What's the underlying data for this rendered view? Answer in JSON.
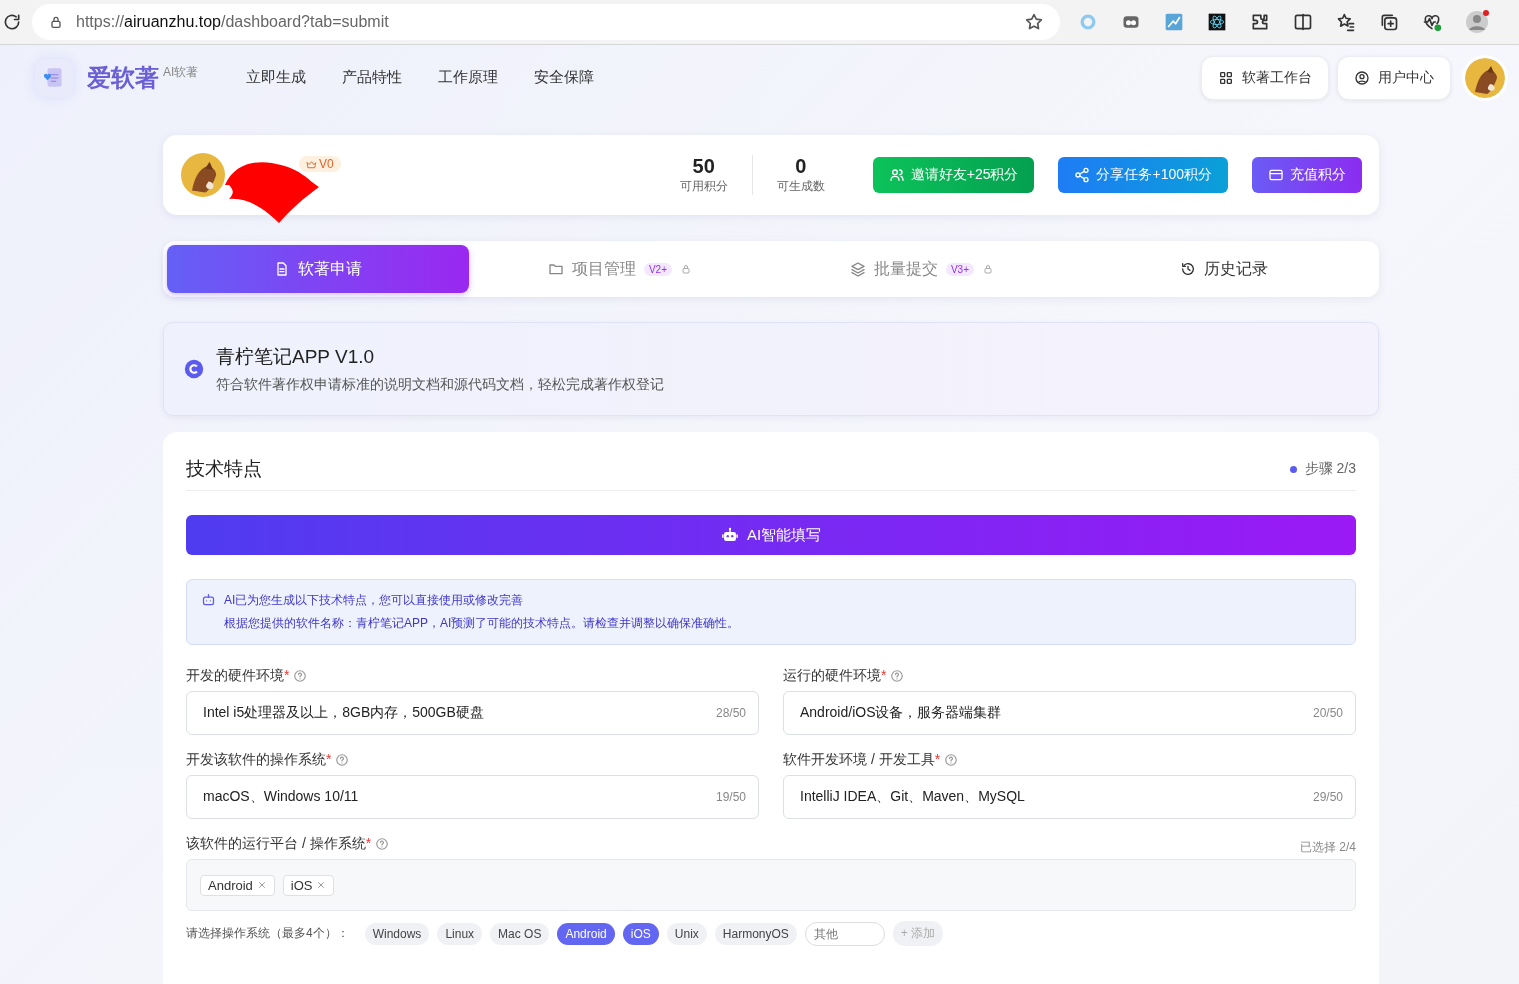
{
  "browser": {
    "url_scheme": "https://",
    "url_host": "airuanzhu.top",
    "url_path": "/dashboard?tab=submit"
  },
  "nav": {
    "brand": "爱软著",
    "brand_tag": "AI软著",
    "links": [
      "立即生成",
      "产品特性",
      "工作原理",
      "安全保障"
    ],
    "buttons": [
      {
        "kind": "workbench",
        "label": "软著工作台"
      },
      {
        "kind": "user",
        "label": "用户中心"
      }
    ]
  },
  "user": {
    "badge": "V0",
    "stats": [
      {
        "value": "50",
        "label": "可用积分"
      },
      {
        "value": "0",
        "label": "可生成数"
      }
    ],
    "actions": [
      {
        "kind": "invite",
        "label": "邀请好友+25积分"
      },
      {
        "kind": "share",
        "label": "分享任务+100积分"
      },
      {
        "kind": "recharge",
        "label": "充值积分"
      }
    ]
  },
  "tabs": [
    {
      "kind": "doc",
      "label": "软著申请",
      "selected": true,
      "locked": false
    },
    {
      "kind": "folder",
      "label": "项目管理",
      "badge": "V2+",
      "selected": false,
      "locked": true
    },
    {
      "kind": "layers",
      "label": "批量提交",
      "badge": "V3+",
      "selected": false,
      "locked": true
    },
    {
      "kind": "history",
      "label": "历史记录",
      "selected": false,
      "locked": false
    }
  ],
  "project": {
    "title": "青柠笔记APP V1.0",
    "description": "符合软件著作权申请标准的说明文档和源代码文档，轻松完成著作权登记"
  },
  "form": {
    "title": "技术特点",
    "step": "步骤 2/3",
    "ai_button": "AI智能填写",
    "notice": {
      "title": "AI已为您生成以下技术特点，您可以直接使用或修改完善",
      "text": "根据您提供的软件名称：青柠笔记APP，AI预测了可能的技术特点。请检查并调整以确保准确性。"
    },
    "fields": [
      {
        "label": "开发的硬件环境",
        "required_mark": "*",
        "value": "Intel i5处理器及以上，8GB内存，500GB硬盘",
        "count": "28/50"
      },
      {
        "label": "运行的硬件环境",
        "required_mark": "*",
        "value": "Android/iOS设备，服务器端集群",
        "count": "20/50"
      },
      {
        "label": "开发该软件的操作系统",
        "required_mark": "*",
        "value": "macOS、Windows 10/11",
        "count": "19/50"
      },
      {
        "label": "软件开发环境 / 开发工具",
        "required_mark": "*",
        "value": "IntelliJ IDEA、Git、Maven、MySQL",
        "count": "29/50"
      }
    ],
    "platform": {
      "label": "该软件的运行平台 / 操作系统",
      "required_mark": "*",
      "selected_count": "已选择 2/4",
      "tags": [
        "Android",
        "iOS"
      ],
      "prompt": "请选择操作系统（最多4个）：",
      "options": [
        {
          "label": "Windows",
          "selected": false
        },
        {
          "label": "Linux",
          "selected": false
        },
        {
          "label": "Mac OS",
          "selected": false
        },
        {
          "label": "Android",
          "selected": true
        },
        {
          "label": "iOS",
          "selected": true
        },
        {
          "label": "Unix",
          "selected": false
        },
        {
          "label": "HarmonyOS",
          "selected": false
        }
      ],
      "other_placeholder": "其他",
      "add": "+ 添加"
    }
  }
}
